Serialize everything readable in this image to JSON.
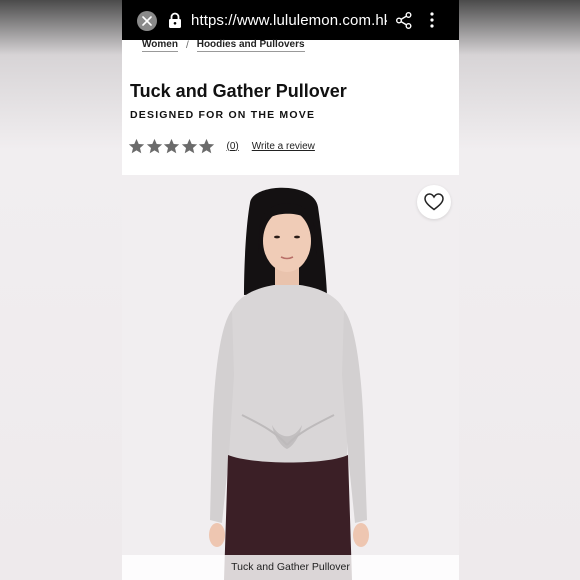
{
  "browser": {
    "url": "https://www.lululemon.com.hk/e"
  },
  "breadcrumb": [
    "Women",
    "Hoodies and Pullovers"
  ],
  "product": {
    "title": "Tuck and Gather Pullover",
    "tagline": "DESIGNED FOR ON THE MOVE",
    "rating_stars": 5,
    "review_count": "(0)",
    "write_review": "Write a review"
  },
  "image": {
    "caption": "Tuck and Gather Pullover"
  },
  "colors": {
    "browser_bar": "#000000",
    "star": "#6b6b6b",
    "top_color": "#d9d6d7",
    "pants_color": "#3b1f26",
    "hair_color": "#141112"
  }
}
